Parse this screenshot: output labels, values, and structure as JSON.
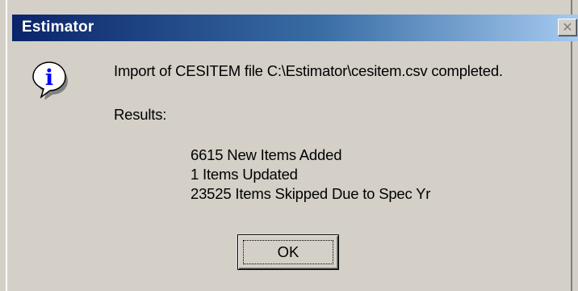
{
  "window": {
    "title": "Estimator",
    "close_icon": "close-icon",
    "close_glyph": "✕"
  },
  "icon": {
    "name": "information-icon",
    "glyph": "i",
    "colors": {
      "bubble": "#ffffff",
      "glyph": "#0000ff",
      "outline": "#000000",
      "shadow": "#808080"
    }
  },
  "message": "Import of CESITEM file C:\\Estimator\\cesitem.csv completed.",
  "results": {
    "label": "Results:",
    "lines": [
      "6615 New Items Added",
      "1 Items Updated",
      "23525 Items Skipped Due to Spec Yr"
    ]
  },
  "buttons": {
    "ok_label": "OK"
  },
  "colors": {
    "dialog_face": "#d4d0c8",
    "title_bar_start": "#0a246a",
    "title_bar_end": "#a6caf0",
    "title_text": "#ffffff"
  }
}
